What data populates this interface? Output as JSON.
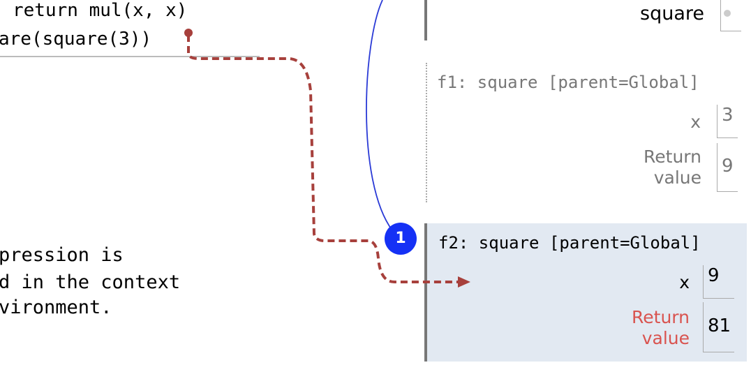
{
  "code": {
    "lines": [
      "return mul(x, x)",
      "are(square(3))"
    ]
  },
  "explanation": {
    "lines": [
      "pression is",
      "d in the context",
      "vironment."
    ]
  },
  "global_frame": {
    "variable": "square"
  },
  "frames": [
    {
      "header": "f1: square [parent=Global]",
      "vars": [
        {
          "name": "x",
          "value": "3"
        }
      ],
      "return_label": [
        "Return",
        "value"
      ],
      "return_value": "9"
    },
    {
      "header": "f2: square [parent=Global]",
      "vars": [
        {
          "name": "x",
          "value": "9"
        }
      ],
      "return_label": [
        "Return",
        "value"
      ],
      "return_value": "81"
    }
  ],
  "step_badge": "1",
  "colors": {
    "arrow": "#a7403c",
    "badge": "#1531f5",
    "active_frame": "#e2e9f2",
    "return_label_active": "#d9534f"
  }
}
